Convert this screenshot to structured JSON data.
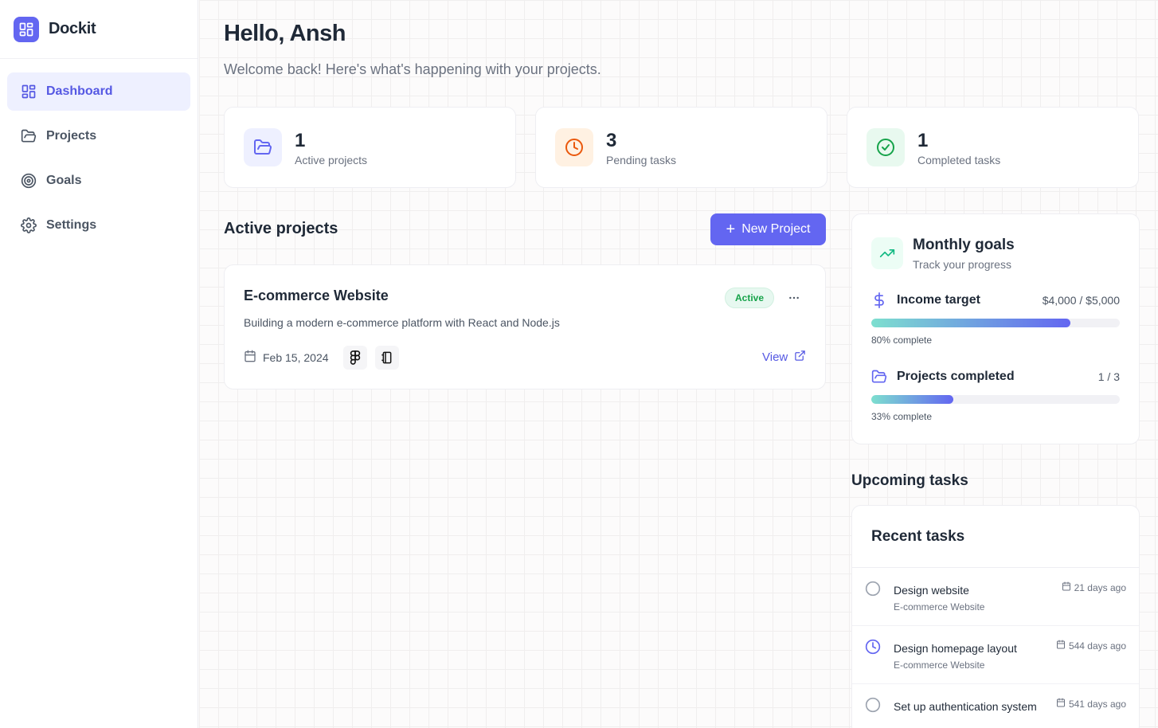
{
  "app": {
    "name": "Dockit"
  },
  "colors": {
    "accent": "#6366f1",
    "active_green": "#16a34a",
    "orange": "#ea580c"
  },
  "sidebar": {
    "items": [
      {
        "label": "Dashboard",
        "icon": "dashboard-icon",
        "active": true
      },
      {
        "label": "Projects",
        "icon": "folder-icon",
        "active": false
      },
      {
        "label": "Goals",
        "icon": "target-icon",
        "active": false
      },
      {
        "label": "Settings",
        "icon": "gear-icon",
        "active": false
      }
    ]
  },
  "header": {
    "greeting": "Hello, Ansh",
    "subtitle": "Welcome back! Here's what's happening with your projects."
  },
  "stats": [
    {
      "value": "1",
      "label": "Active projects",
      "icon": "folder-open-icon"
    },
    {
      "value": "3",
      "label": "Pending tasks",
      "icon": "clock-icon"
    },
    {
      "value": "1",
      "label": "Completed tasks",
      "icon": "check-circle-icon"
    }
  ],
  "projects_section": {
    "title": "Active projects",
    "new_button": "New Project",
    "items": [
      {
        "name": "E-commerce Website",
        "description": "Building a modern e-commerce platform with React and Node.js",
        "status": "Active",
        "date": "Feb 15, 2024",
        "tools": [
          "figma-icon",
          "notion-icon"
        ],
        "view_label": "View"
      }
    ]
  },
  "goals": {
    "title": "Monthly goals",
    "subtitle": "Track your progress",
    "items": [
      {
        "name": "Income target",
        "value": "$4,000 / $5,000",
        "progress": 0.8,
        "pct_label": "80% complete",
        "icon": "dollar-icon"
      },
      {
        "name": "Projects completed",
        "value": "1 / 3",
        "progress": 0.33,
        "pct_label": "33% complete",
        "icon": "folder-icon"
      }
    ]
  },
  "upcoming": {
    "title": "Upcoming tasks",
    "card_title": "Recent tasks",
    "tasks": [
      {
        "title": "Design website",
        "project": "E-commerce Website",
        "time": "21 days ago",
        "status": "todo"
      },
      {
        "title": "Design homepage layout",
        "project": "E-commerce Website",
        "time": "544 days ago",
        "status": "in-progress"
      },
      {
        "title": "Set up authentication system",
        "project": "",
        "time": "541 days ago",
        "status": "todo"
      }
    ]
  }
}
